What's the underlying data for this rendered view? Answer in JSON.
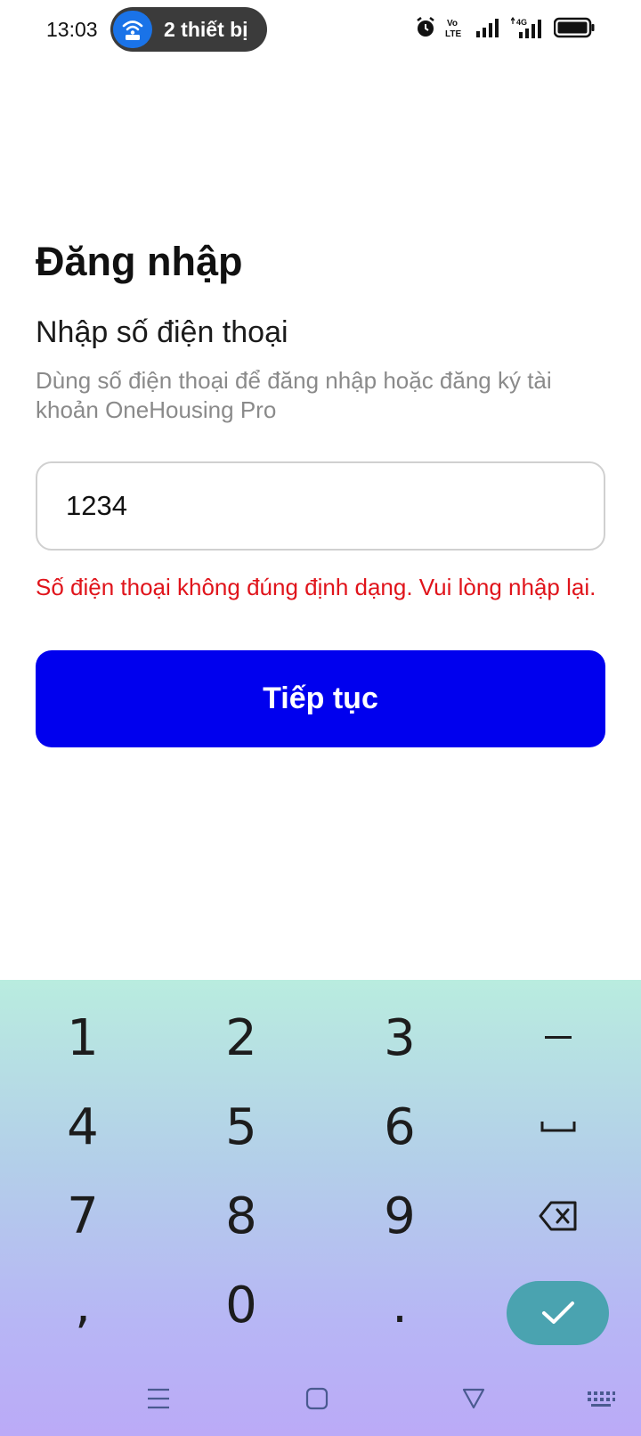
{
  "status_bar": {
    "time": "13:03",
    "hotspot_label": "2 thiết bị",
    "icons": [
      "alarm-icon",
      "volte-icon",
      "signal-icon",
      "4g-signal-icon",
      "battery-icon"
    ],
    "volte_top": "Vo",
    "volte_bottom": "LTE",
    "network_label": "4G"
  },
  "login": {
    "title": "Đăng nhập",
    "subtitle": "Nhập số điện thoại",
    "description": "Dùng số điện thoại để đăng nhập hoặc đăng ký tài khoản OneHousing Pro",
    "phone_value": "1234",
    "error": "Số điện thoại không đúng định dạng. Vui lòng nhập lại.",
    "continue_label": "Tiếp tục"
  },
  "keyboard": {
    "keys": [
      "1",
      "2",
      "3",
      "–",
      "4",
      "5",
      "6",
      "␣",
      "7",
      "8",
      "9",
      "⌫",
      ",",
      "0",
      ".",
      "✓"
    ]
  },
  "colors": {
    "primary_button": "#0000ee",
    "error": "#e0141b",
    "done_key": "#4aa3b0",
    "hotspot_accent": "#1a73e8"
  }
}
